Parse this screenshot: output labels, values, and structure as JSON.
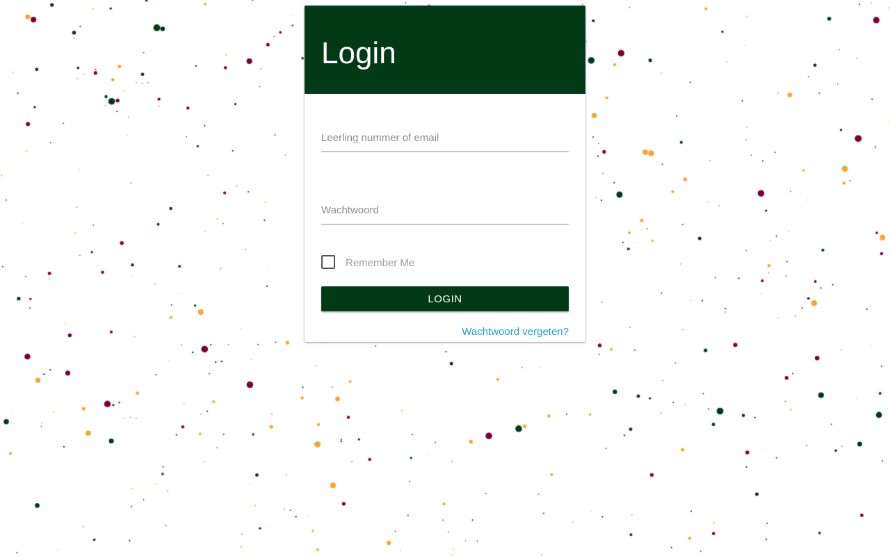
{
  "login": {
    "title": "Login",
    "username_placeholder": "Leerling nummer of email",
    "username_value": "",
    "password_placeholder": "Wachtwoord",
    "password_value": "",
    "remember_label": "Remember Me",
    "remember_checked": false,
    "submit_label": "LOGIN",
    "forgot_label": "Wachtwoord vergeten?"
  },
  "colors": {
    "primary": "#023a15",
    "particle_green": "#023a15",
    "particle_maroon": "#7a0034",
    "particle_orange": "#f3a630",
    "link": "#1a9bd7"
  }
}
